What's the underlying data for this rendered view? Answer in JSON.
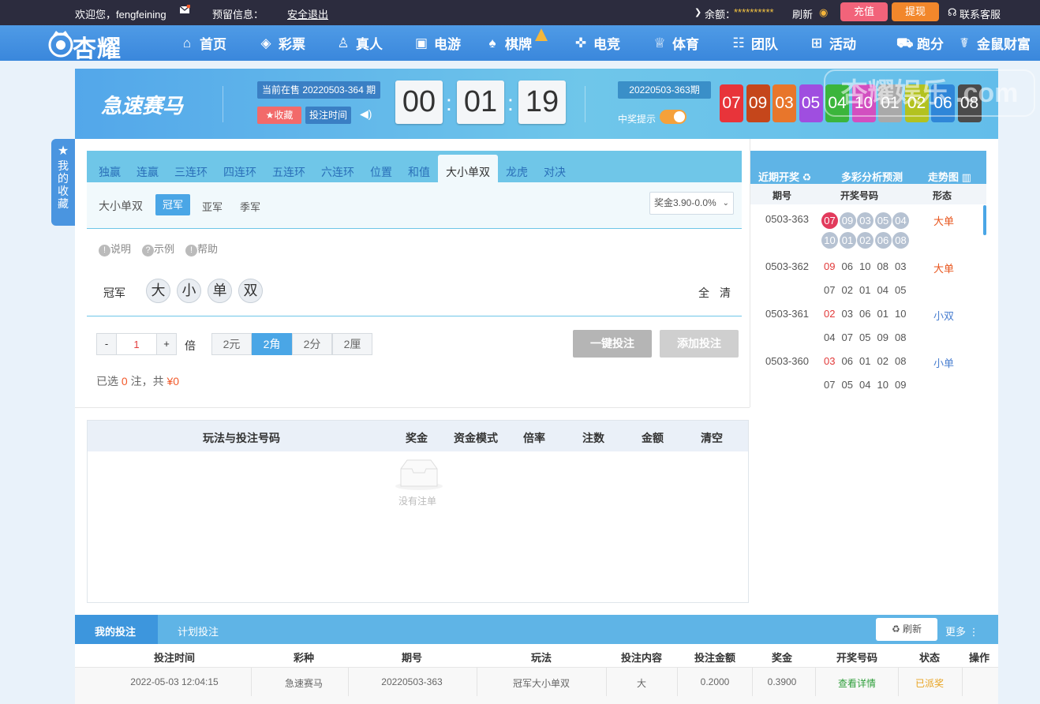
{
  "topbar": {
    "welcome": "欢迎您，fengfeining",
    "reserve_info": "预留信息：",
    "logout": "安全退出",
    "balance_label": "余额：",
    "balance_value": "**********",
    "refresh": "刷新",
    "recharge": "充值",
    "withdraw": "提现",
    "service": "联系客服"
  },
  "nav": {
    "logo": "杏耀",
    "items": [
      "首页",
      "彩票",
      "真人",
      "电游",
      "棋牌",
      "电竞",
      "体育",
      "团队",
      "活动",
      "跑分",
      "金鼠财富"
    ]
  },
  "watermark": "杏耀娱乐 .com",
  "header": {
    "game_name": "急速赛马",
    "current_period": "当前在售 20220503-364 期",
    "favorite": "收藏",
    "bet_time": "投注时间",
    "countdown": [
      "00",
      "01",
      "19"
    ],
    "last_period": "20220503-363期",
    "win_prompt": "中奖提示",
    "result_balls": [
      "07",
      "09",
      "03",
      "05",
      "04",
      "10",
      "01",
      "02",
      "06",
      "08"
    ],
    "ball_colors": [
      "#e8343a",
      "#c5461b",
      "#e8762b",
      "#9f4ee0",
      "#3bb53c",
      "#d24fc0",
      "#a9a9a9",
      "#b3c21f",
      "#2f86d8",
      "#4b4b4b"
    ]
  },
  "side_fav": "我的收藏",
  "tabs": [
    "独赢",
    "连赢",
    "三连环",
    "四连环",
    "五连环",
    "六连环",
    "位置",
    "和值",
    "大小单双",
    "龙虎",
    "对决"
  ],
  "active_tab": "大小单双",
  "subtabs": {
    "label": "大小单双",
    "items": [
      "冠军",
      "亚军",
      "季军"
    ],
    "active": "冠军",
    "prize_select": "奖金3.90-0.0%"
  },
  "help_links": [
    "说明",
    "示例",
    "帮助"
  ],
  "pick": {
    "row_label": "冠军",
    "options": [
      "大",
      "小",
      "单",
      "双"
    ],
    "all": "全",
    "clear": "清"
  },
  "multiplier": {
    "minus": "-",
    "value": "1",
    "plus": "+",
    "unit": "倍",
    "money_modes": [
      "2元",
      "2角",
      "2分",
      "2厘"
    ],
    "active_mode": "2角"
  },
  "actions": {
    "one_click": "一键投注",
    "add": "添加投注"
  },
  "selected": {
    "prefix": "已选",
    "count": "0",
    "mid": "注，共",
    "amount": "¥0"
  },
  "recent": {
    "header": [
      "近期开奖",
      "多彩分析预测",
      "走势图"
    ],
    "cols": [
      "期号",
      "开奖号码",
      "形态"
    ],
    "rows": [
      {
        "period": "0503-363",
        "numbers": [
          "07",
          "09",
          "03",
          "05",
          "04",
          "10",
          "01",
          "02",
          "06",
          "08"
        ],
        "shape": "大单"
      },
      {
        "period": "0503-362",
        "numbers": [
          "09",
          "06",
          "10",
          "08",
          "03",
          "07",
          "02",
          "01",
          "04",
          "05"
        ],
        "shape": "大单"
      },
      {
        "period": "0503-361",
        "numbers": [
          "02",
          "03",
          "06",
          "01",
          "10",
          "04",
          "07",
          "05",
          "09",
          "08"
        ],
        "shape": "小双"
      },
      {
        "period": "0503-360",
        "numbers": [
          "03",
          "06",
          "01",
          "02",
          "08",
          "07",
          "05",
          "04",
          "10",
          "09"
        ],
        "shape": "小单"
      }
    ]
  },
  "bet_table": {
    "columns": [
      "玩法与投注号码",
      "奖金",
      "资金模式",
      "倍率",
      "注数",
      "金额",
      "清空"
    ],
    "empty": "没有注单"
  },
  "bottom": {
    "tabs": [
      "我的投注",
      "计划投注"
    ],
    "refresh": "刷新",
    "more": "更多",
    "columns": [
      "投注时间",
      "彩种",
      "期号",
      "玩法",
      "投注内容",
      "投注金额",
      "奖金",
      "开奖号码",
      "状态",
      "操作"
    ],
    "rows": [
      [
        "2022-05-03 12:04:15",
        "急速赛马",
        "20220503-363",
        "冠军大小单双",
        "大",
        "0.2000",
        "0.3900",
        "查看详情",
        "已派奖",
        ""
      ]
    ]
  }
}
